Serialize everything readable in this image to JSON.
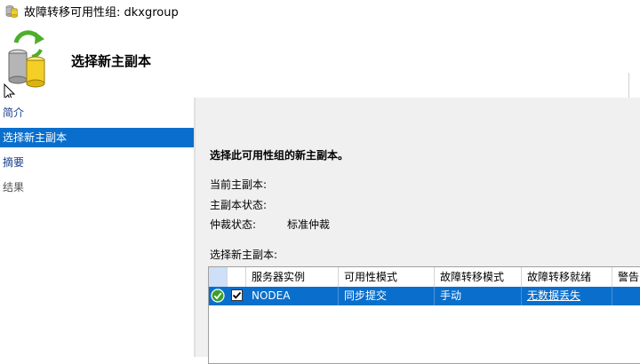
{
  "window": {
    "title": "故障转移可用性组: dkxgroup"
  },
  "header": {
    "heading": "选择新主副本"
  },
  "sidebar": {
    "items": [
      {
        "label": "简介",
        "state": "link"
      },
      {
        "label": "选择新主副本",
        "state": "active"
      },
      {
        "label": "摘要",
        "state": "link"
      },
      {
        "label": "结果",
        "state": "disabled"
      }
    ]
  },
  "main": {
    "description": "选择此可用性组的新主副本。",
    "current_primary_label": "当前主副本:",
    "current_primary_value": "",
    "primary_state_label": "主副本状态:",
    "primary_state_value": "",
    "arbitration_label": "仲裁状态:",
    "arbitration_value": "标准仲裁",
    "select_label": "选择新主副本:"
  },
  "grid": {
    "columns": [
      "服务器实例",
      "可用性模式",
      "故障转移模式",
      "故障转移就绪",
      "警告"
    ],
    "rows": [
      {
        "checked": true,
        "status": "ok",
        "cells": [
          "NODEA",
          "同步提交",
          "手动",
          "无数据丢失",
          ""
        ]
      }
    ]
  },
  "colors": {
    "selection": "#0a6fcc",
    "link": "#1a3e8c",
    "panel_bg": "#f0f0f0"
  }
}
